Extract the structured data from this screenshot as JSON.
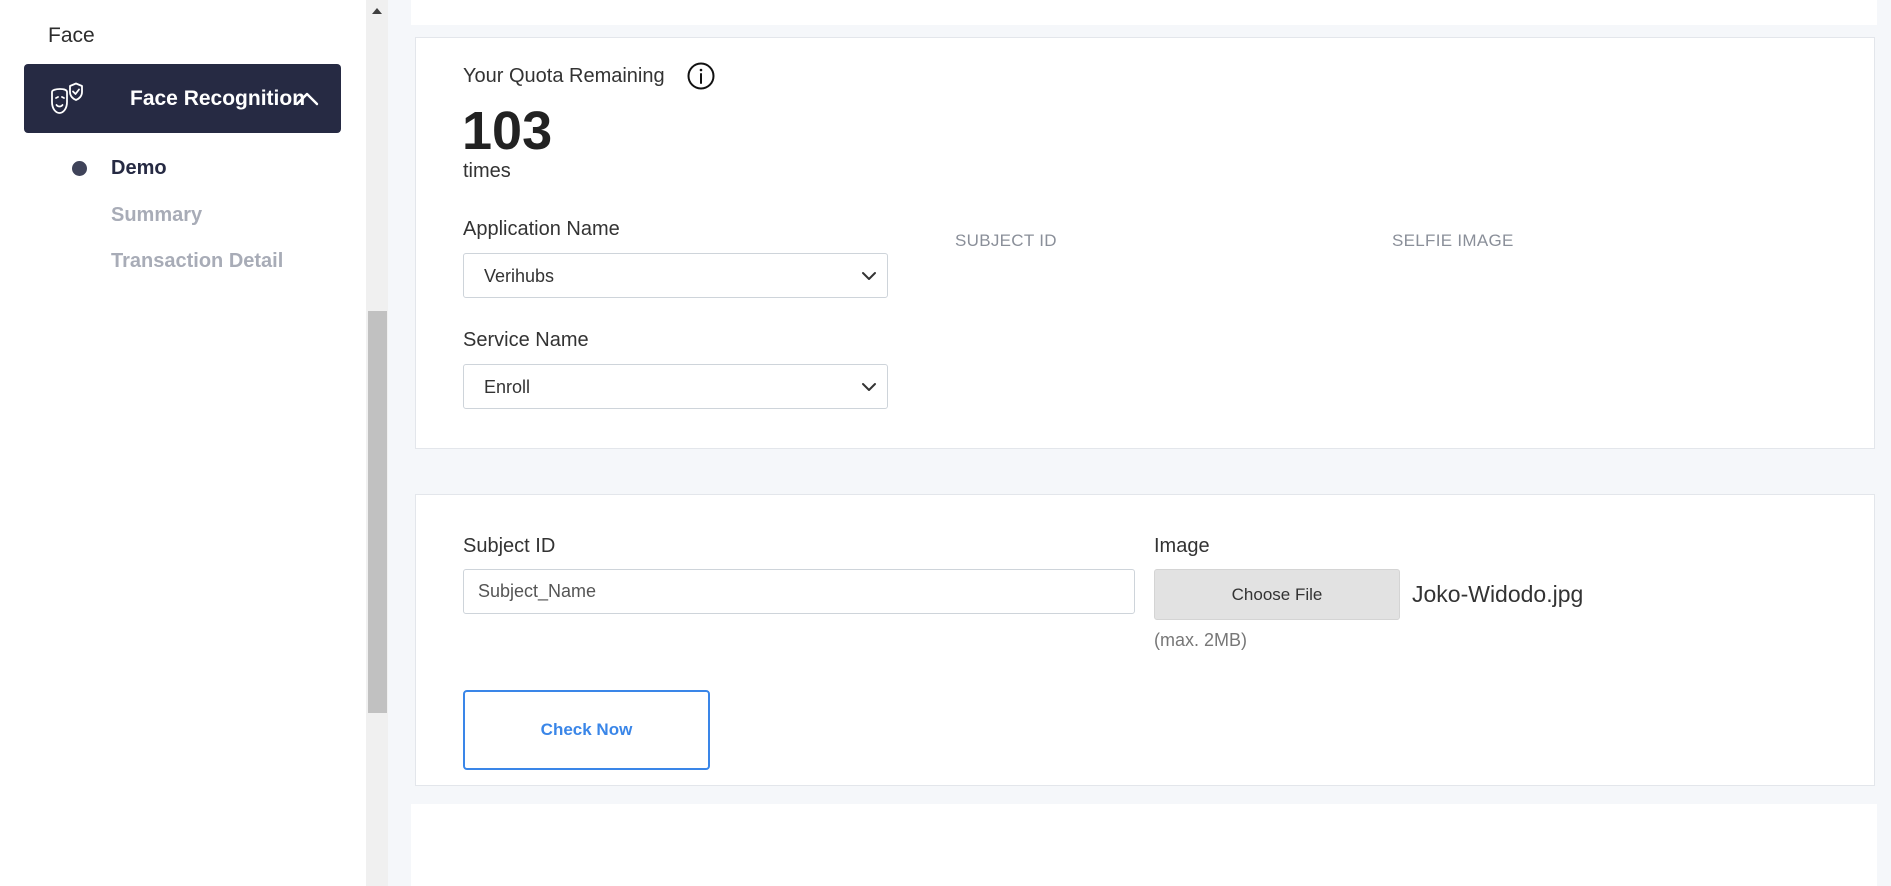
{
  "sidebar": {
    "section_label": "Face",
    "active_menu": {
      "label": "Face Recognition",
      "icon": "face-mask-shield-icon"
    },
    "sub_items": [
      {
        "label": "Demo",
        "active": true
      },
      {
        "label": "Summary",
        "active": false
      },
      {
        "label": "Transaction Detail",
        "active": false
      }
    ]
  },
  "quota": {
    "label": "Your Quota Remaining",
    "value": "103",
    "unit": "times"
  },
  "form": {
    "application_name_label": "Application Name",
    "application_name_value": "Verihubs",
    "service_name_label": "Service Name",
    "service_name_value": "Enroll",
    "subject_id_header": "SUBJECT ID",
    "selfie_image_header": "SELFIE IMAGE"
  },
  "upload": {
    "subject_id_label": "Subject ID",
    "subject_id_value": "Subject_Name",
    "image_label": "Image",
    "choose_file_label": "Choose File",
    "file_name": "Joko-Widodo.jpg",
    "file_hint": "(max. 2MB)",
    "check_button_label": "Check Now"
  },
  "colors": {
    "sidebar_active_bg": "#262a43",
    "accent": "#3a86e8",
    "muted_text": "#a8acb7"
  }
}
